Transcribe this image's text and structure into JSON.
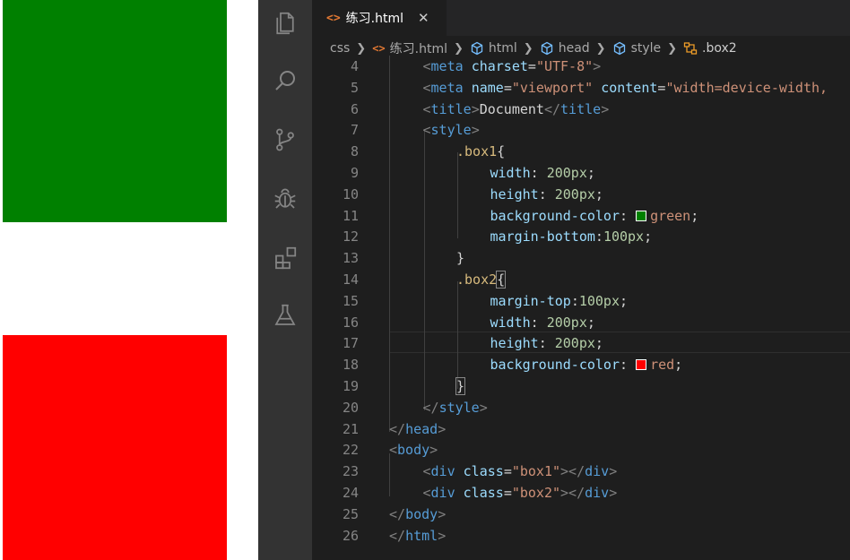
{
  "preview": {
    "box1_color": "#008000",
    "box2_color": "#ff0000"
  },
  "activity_bar": {
    "items": [
      "explorer-icon",
      "search-icon",
      "source-control-icon",
      "debug-icon",
      "extensions-icon",
      "testing-icon"
    ]
  },
  "tab": {
    "label": "练习.html",
    "icon_text": "<>",
    "close": "✕"
  },
  "breadcrumb": {
    "items": [
      "css",
      "练习.html",
      "html",
      "head",
      "style",
      ".box2"
    ]
  },
  "editor": {
    "lines": [
      {
        "n": "4",
        "indent": 1,
        "tokens": [
          [
            "t-punct",
            "<"
          ],
          [
            "t-tag",
            "meta"
          ],
          [
            "t-text",
            " "
          ],
          [
            "t-attr",
            "charset"
          ],
          [
            "t-text",
            "="
          ],
          [
            "t-str",
            "\"UTF-8\""
          ],
          [
            "t-punct",
            ">"
          ]
        ]
      },
      {
        "n": "5",
        "indent": 1,
        "tokens": [
          [
            "t-punct",
            "<"
          ],
          [
            "t-tag",
            "meta"
          ],
          [
            "t-text",
            " "
          ],
          [
            "t-attr",
            "name"
          ],
          [
            "t-text",
            "="
          ],
          [
            "t-str",
            "\"viewport\""
          ],
          [
            "t-text",
            " "
          ],
          [
            "t-attr",
            "content"
          ],
          [
            "t-text",
            "="
          ],
          [
            "t-str",
            "\"width=device-width,"
          ]
        ]
      },
      {
        "n": "6",
        "indent": 1,
        "tokens": [
          [
            "t-punct",
            "<"
          ],
          [
            "t-tag",
            "title"
          ],
          [
            "t-punct",
            ">"
          ],
          [
            "t-text",
            "Document"
          ],
          [
            "t-punct",
            "</"
          ],
          [
            "t-tag",
            "title"
          ],
          [
            "t-punct",
            ">"
          ]
        ]
      },
      {
        "n": "7",
        "indent": 1,
        "tokens": [
          [
            "t-punct",
            "<"
          ],
          [
            "t-tag",
            "style"
          ],
          [
            "t-punct",
            ">"
          ]
        ]
      },
      {
        "n": "8",
        "indent": 2,
        "tokens": [
          [
            "t-sel",
            ".box1"
          ],
          [
            "t-text",
            "{"
          ]
        ]
      },
      {
        "n": "9",
        "indent": 3,
        "tokens": [
          [
            "t-prop",
            "width"
          ],
          [
            "t-text",
            ": "
          ],
          [
            "t-num",
            "200px"
          ],
          [
            "t-text",
            ";"
          ]
        ]
      },
      {
        "n": "10",
        "indent": 3,
        "tokens": [
          [
            "t-prop",
            "height"
          ],
          [
            "t-text",
            ": "
          ],
          [
            "t-num",
            "200px"
          ],
          [
            "t-text",
            ";"
          ]
        ]
      },
      {
        "n": "11",
        "indent": 3,
        "tokens": [
          [
            "t-prop",
            "background-color"
          ],
          [
            "t-text",
            ": "
          ],
          [
            "swatch",
            "#008000"
          ],
          [
            "t-val",
            "green"
          ],
          [
            "t-text",
            ";"
          ]
        ]
      },
      {
        "n": "12",
        "indent": 3,
        "tokens": [
          [
            "t-prop",
            "margin-bottom"
          ],
          [
            "t-text",
            ":"
          ],
          [
            "t-num",
            "100px"
          ],
          [
            "t-text",
            ";"
          ]
        ]
      },
      {
        "n": "13",
        "indent": 2,
        "tokens": [
          [
            "t-text",
            "}"
          ]
        ]
      },
      {
        "n": "14",
        "indent": 2,
        "tokens": [
          [
            "t-sel",
            ".box2"
          ],
          [
            "bracket",
            "{"
          ]
        ]
      },
      {
        "n": "15",
        "indent": 3,
        "tokens": [
          [
            "t-prop",
            "margin-top"
          ],
          [
            "t-text",
            ":"
          ],
          [
            "t-num",
            "100px"
          ],
          [
            "t-text",
            ";"
          ]
        ]
      },
      {
        "n": "16",
        "indent": 3,
        "tokens": [
          [
            "t-prop",
            "width"
          ],
          [
            "t-text",
            ": "
          ],
          [
            "t-num",
            "200px"
          ],
          [
            "t-text",
            ";"
          ]
        ]
      },
      {
        "n": "17",
        "indent": 3,
        "tokens": [
          [
            "t-prop",
            "height"
          ],
          [
            "t-text",
            ": "
          ],
          [
            "t-num",
            "200px"
          ],
          [
            "t-text",
            ";"
          ]
        ]
      },
      {
        "n": "18",
        "indent": 3,
        "tokens": [
          [
            "t-prop",
            "background-color"
          ],
          [
            "t-text",
            ": "
          ],
          [
            "swatch",
            "#ff0000"
          ],
          [
            "t-val",
            "red"
          ],
          [
            "t-text",
            ";"
          ]
        ]
      },
      {
        "n": "19",
        "indent": 2,
        "tokens": [
          [
            "bracket",
            "}"
          ]
        ]
      },
      {
        "n": "20",
        "indent": 1,
        "tokens": [
          [
            "t-punct",
            "</"
          ],
          [
            "t-tag",
            "style"
          ],
          [
            "t-punct",
            ">"
          ]
        ]
      },
      {
        "n": "21",
        "indent": 0,
        "tokens": [
          [
            "t-punct",
            "</"
          ],
          [
            "t-tag",
            "head"
          ],
          [
            "t-punct",
            ">"
          ]
        ]
      },
      {
        "n": "22",
        "indent": 0,
        "tokens": [
          [
            "t-punct",
            "<"
          ],
          [
            "t-tag",
            "body"
          ],
          [
            "t-punct",
            ">"
          ]
        ]
      },
      {
        "n": "23",
        "indent": 1,
        "tokens": [
          [
            "t-punct",
            "<"
          ],
          [
            "t-tag",
            "div"
          ],
          [
            "t-text",
            " "
          ],
          [
            "t-attr",
            "class"
          ],
          [
            "t-text",
            "="
          ],
          [
            "t-str",
            "\"box1\""
          ],
          [
            "t-punct",
            "></"
          ],
          [
            "t-tag",
            "div"
          ],
          [
            "t-punct",
            ">"
          ]
        ]
      },
      {
        "n": "24",
        "indent": 1,
        "tokens": [
          [
            "t-punct",
            "<"
          ],
          [
            "t-tag",
            "div"
          ],
          [
            "t-text",
            " "
          ],
          [
            "t-attr",
            "class"
          ],
          [
            "t-text",
            "="
          ],
          [
            "t-str",
            "\"box2\""
          ],
          [
            "t-punct",
            "></"
          ],
          [
            "t-tag",
            "div"
          ],
          [
            "t-punct",
            ">"
          ]
        ]
      },
      {
        "n": "25",
        "indent": 0,
        "tokens": [
          [
            "t-punct",
            "</"
          ],
          [
            "t-tag",
            "body"
          ],
          [
            "t-punct",
            ">"
          ]
        ]
      },
      {
        "n": "26",
        "indent": 0,
        "tokens": [
          [
            "t-punct",
            "</"
          ],
          [
            "t-tag",
            "html"
          ],
          [
            "t-punct",
            ">"
          ]
        ]
      }
    ]
  }
}
